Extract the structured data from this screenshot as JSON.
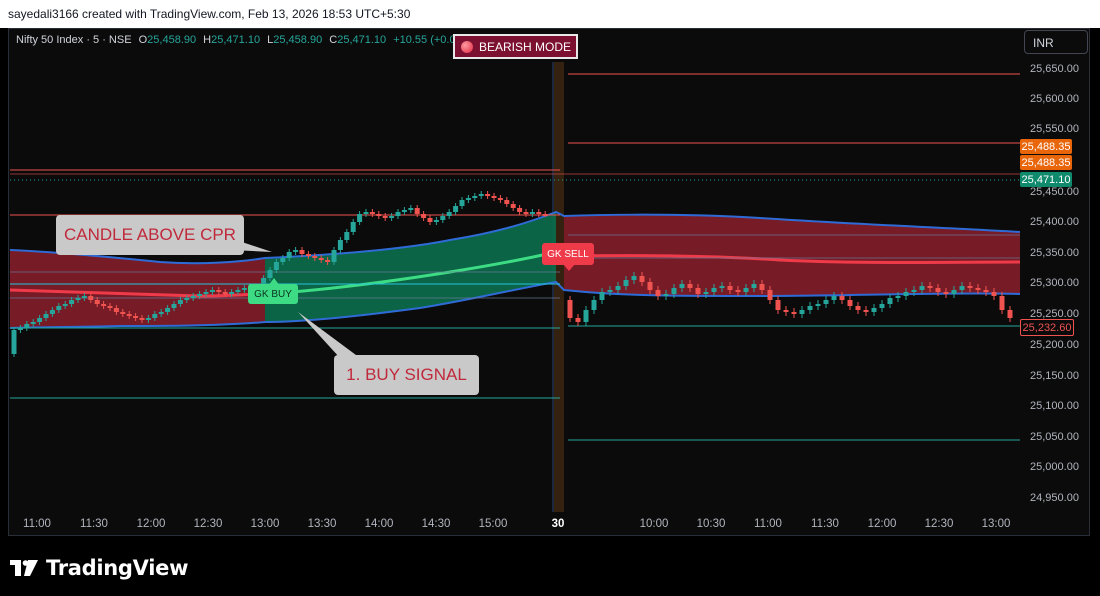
{
  "header": {
    "text": "sayedali3166 created with TradingView.com, Feb 13, 2026 18:53 UTC+5:30"
  },
  "legend": {
    "symbol": "Nifty 50 Index · 5 · NSE",
    "open_label": "O",
    "open": "25,458.90",
    "high_label": "H",
    "high": "25,471.10",
    "low_label": "L",
    "low": "25,458.90",
    "close_label": "C",
    "close": "25,471.10",
    "change": "+10.55 (+0.04%)"
  },
  "mode_badge": {
    "label": "BEARISH MODE"
  },
  "currency": {
    "label": "INR"
  },
  "callouts": {
    "candle_above_cpr": "CANDLE ABOVE CPR",
    "buy_signal": "1. BUY SIGNAL"
  },
  "signals": {
    "buy": "GK BUY",
    "sell": "GK SELL"
  },
  "price_tags": [
    {
      "label": "25,488.35",
      "color": "#e8650a"
    },
    {
      "label": "25,488.35",
      "color": "#e8650a"
    },
    {
      "label": "25,471.10",
      "color": "#0f8a6c"
    },
    {
      "label": "25,232.60",
      "color": "#0b0b0b"
    }
  ],
  "yaxis": {
    "ticks": [
      "25,650.00",
      "25,600.00",
      "25,550.00",
      "25,450.00",
      "25,400.00",
      "25,350.00",
      "25,300.00",
      "25,250.00",
      "25,200.00",
      "25,150.00",
      "25,100.00",
      "25,050.00",
      "25,000.00",
      "24,950.00"
    ]
  },
  "xaxis": {
    "ticks": [
      "11:00",
      "11:30",
      "12:00",
      "12:30",
      "13:00",
      "13:30",
      "14:00",
      "14:30",
      "15:00",
      "30",
      "10:00",
      "10:30",
      "11:00",
      "11:30",
      "12:00",
      "12:30",
      "13:00"
    ]
  },
  "brand": {
    "name": "TradingView"
  },
  "colors": {
    "bull": "#26a69a",
    "bear": "#ef5350",
    "band_red": "#8b1e2c",
    "band_green": "#0a6e4b",
    "band_edge": "#2f6bd6"
  }
}
